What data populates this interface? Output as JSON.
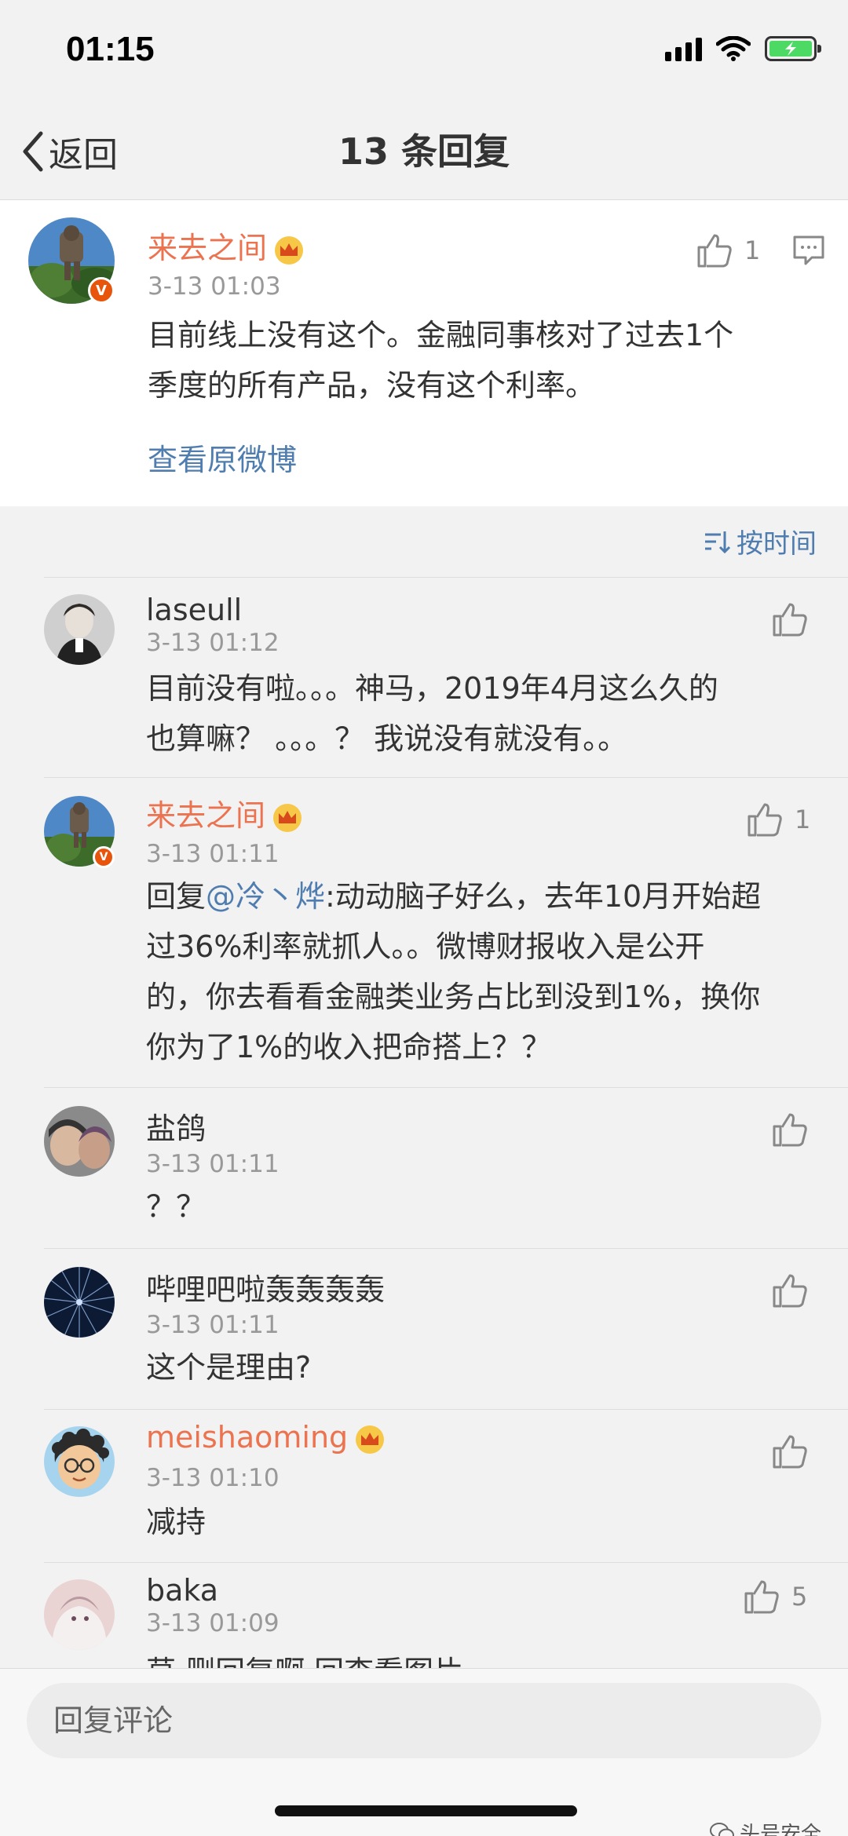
{
  "status": {
    "time": "01:15"
  },
  "nav": {
    "back_label": "返回",
    "title": "13 条回复"
  },
  "main_post": {
    "username": "来去之间",
    "time": "3-13 01:03",
    "likes": "1",
    "lines": [
      "目前线上没有这个。金融同事核对了过去1个",
      "季度的所有产品，没有这个利率。"
    ],
    "view_origin": "查看原微博"
  },
  "sort": {
    "label": "按时间"
  },
  "comments": [
    {
      "username": "laseull",
      "time": "3-13 01:12",
      "likes": "",
      "lines": [
        "目前没有啦。。。神马，2019年4月这么久的",
        "也算嘛？ 。。。？ 我说没有就没有。。"
      ]
    },
    {
      "username": "来去之间",
      "time": "3-13 01:11",
      "likes": "1",
      "reply_prefix": "回复",
      "mention": "@冷丶烨",
      "lines": [
        ":动动脑子好么，去年10月开始超",
        "过36%利率就抓人。。微博财报收入是公开",
        "的，你去看看金融类业务占比到没到1%，换你",
        "你为了1%的收入把命搭上？？"
      ]
    },
    {
      "username": "盐鸽",
      "time": "3-13 01:11",
      "likes": "",
      "lines": [
        "？？"
      ]
    },
    {
      "username": "哔哩吧啦轰轰轰轰",
      "time": "3-13 01:11",
      "likes": "",
      "lines": [
        "这个是理由?"
      ]
    },
    {
      "username": "meishaoming",
      "time": "3-13 01:10",
      "likes": "",
      "lines": [
        "减持"
      ]
    },
    {
      "username": "baka",
      "time": "3-13 01:09",
      "likes": "5",
      "lines": [
        "草 删回复啊 回查看图片"
      ]
    }
  ],
  "reply_bar": {
    "placeholder": "回复评论"
  },
  "watermark": {
    "text": "头号安全"
  },
  "colors": {
    "vip_name": "#eb7350",
    "link": "#507daf",
    "time": "#999999"
  }
}
